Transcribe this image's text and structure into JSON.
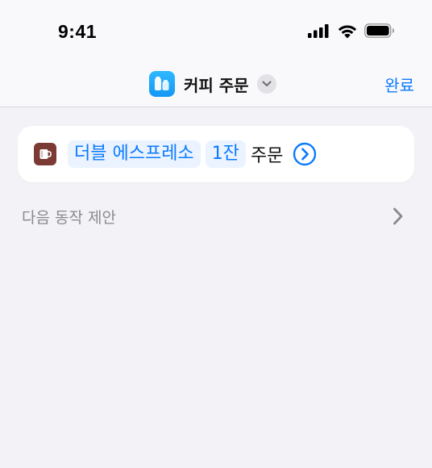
{
  "status_bar": {
    "time": "9:41",
    "icons": [
      "cellular-signal-icon",
      "wifi-icon",
      "battery-icon"
    ]
  },
  "nav": {
    "app_icon": "shortcuts-app-icon",
    "title": "커피 주문",
    "chevron_icon": "chevron-down-icon",
    "done_label": "완료"
  },
  "action": {
    "icon": "coffee-cup-icon",
    "drink": "더블 에스프레소",
    "quantity": "1잔",
    "verb": "주문",
    "go_icon": "arrow-right-circle-icon"
  },
  "suggestions": {
    "label": "다음 동작 제안",
    "chevron_icon": "chevron-right-icon"
  },
  "colors": {
    "accent": "#0a7aff",
    "token_bg": "#eaf3ff",
    "background": "#f2f2f7",
    "coffee_icon_bg": "#7b3b34",
    "app_icon_bg": "#1ea8fb"
  }
}
